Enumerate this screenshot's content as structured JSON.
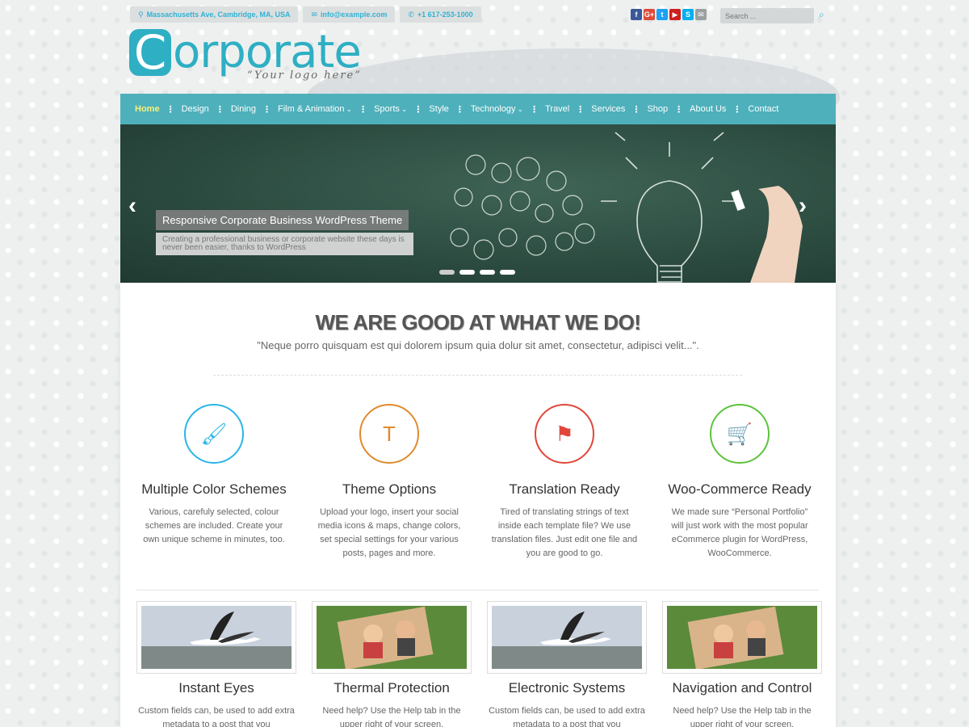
{
  "topbar": {
    "address": "Massachusetts Ave, Cambridge, MA, USA",
    "email": "info@example.com",
    "phone": "+1 617-253-1000"
  },
  "social": [
    {
      "icon": "facebook-icon",
      "glyph": "f",
      "color": "#3b5998"
    },
    {
      "icon": "google-plus-icon",
      "glyph": "G+",
      "color": "#dd4b39"
    },
    {
      "icon": "twitter-icon",
      "glyph": "t",
      "color": "#1da1f2"
    },
    {
      "icon": "youtube-icon",
      "glyph": "▶",
      "color": "#cd201f"
    },
    {
      "icon": "skype-icon",
      "glyph": "S",
      "color": "#00aff0"
    },
    {
      "icon": "email-icon",
      "glyph": "✉",
      "color": "#9aa0a2"
    }
  ],
  "search": {
    "placeholder": "Search ..."
  },
  "logo": {
    "letter": "C",
    "rest": "orporate",
    "tagline": "“Your logo here”"
  },
  "nav": {
    "items": [
      {
        "label": "Home",
        "active": true,
        "dropdown": false
      },
      {
        "label": "Design",
        "dropdown": false
      },
      {
        "label": "Dining",
        "dropdown": false
      },
      {
        "label": "Film & Animation",
        "dropdown": true
      },
      {
        "label": "Sports",
        "dropdown": true
      },
      {
        "label": "Style",
        "dropdown": false
      },
      {
        "label": "Technology",
        "dropdown": true
      },
      {
        "label": "Travel",
        "dropdown": false
      },
      {
        "label": "Services",
        "dropdown": false
      },
      {
        "label": "Shop",
        "dropdown": false
      },
      {
        "label": "About Us",
        "dropdown": false
      },
      {
        "label": "Contact",
        "dropdown": false
      }
    ]
  },
  "slider": {
    "title": "Responsive Corporate Business WordPress Theme",
    "text": "Creating a professional business or corporate website these days is never been easier, thanks to WordPress",
    "prev": "‹",
    "next": "›",
    "slide_count": 4,
    "active_index": 0
  },
  "intro": {
    "headline": "WE ARE GOOD AT WHAT WE DO!",
    "subhead": "\"Neque porro quisquam est qui dolorem ipsum quia dolur sit amet, consectetur, adipisci velit...\"."
  },
  "features": [
    {
      "title": "Multiple Color Schemes",
      "text": "Various, carefuly selected, colour schemes are included. Create your own unique scheme in minutes, too.",
      "icon": "paintbrush-icon",
      "glyph": "🖌",
      "color": "#29b6e8"
    },
    {
      "title": "Theme Options",
      "text": "Upload your logo, insert your social media icons & maps, change colors, set special settings for your various posts, pages and more.",
      "icon": "text-format-icon",
      "glyph": "T",
      "color": "#e08a2e"
    },
    {
      "title": "Translation Ready",
      "text": "Tired of translating strings of text inside each template file? We use translation files. Just edit one file and you are good to go.",
      "icon": "flag-icon",
      "glyph": "⚑",
      "color": "#e2463a"
    },
    {
      "title": "Woo-Commerce Ready",
      "text": "We made sure “Personal Portfolio” will just work with the most popular eCommerce plugin for WordPress, WooCommerce.",
      "icon": "shopping-cart-icon",
      "glyph": "🛒",
      "color": "#5cc33a"
    }
  ],
  "cards": [
    {
      "title": "Instant Eyes",
      "text": "Custom fields can, be used to add extra metadata to a post that you",
      "image": "stork-image"
    },
    {
      "title": "Thermal Protection",
      "text": "Need help? Use the Help tab in the upper right of your screen.",
      "image": "cartoon-couple-image"
    },
    {
      "title": "Electronic Systems",
      "text": "Custom fields can, be used to add extra metadata to a post that you",
      "image": "stork-image"
    },
    {
      "title": "Navigation and Control",
      "text": "Need help? Use the Help tab in the upper right of your screen.",
      "image": "cartoon-couple-image"
    }
  ]
}
